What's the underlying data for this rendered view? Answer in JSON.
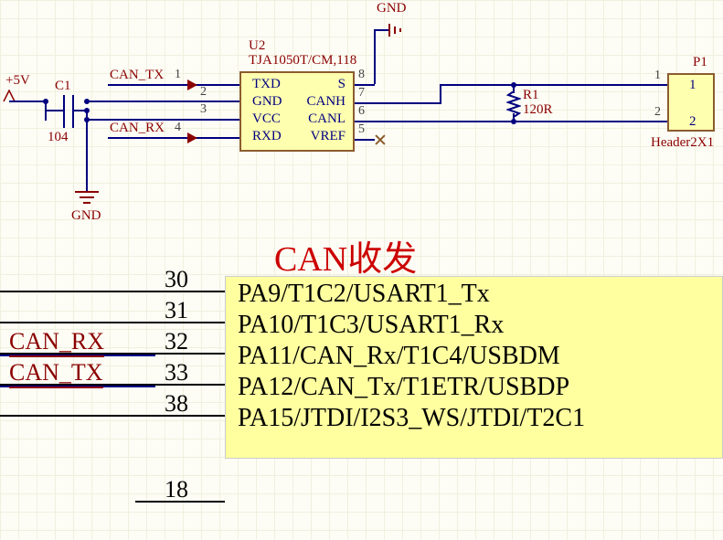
{
  "title": "CAN收发",
  "power": {
    "vcc": "+5V",
    "gnd_top": "GND",
    "gnd_left": "GND"
  },
  "c1": {
    "ref": "C1",
    "value": "104"
  },
  "u2": {
    "ref": "U2",
    "part": "TJA1050T/CM,118",
    "pins": {
      "p1": {
        "num": "1",
        "name": "TXD",
        "net": "CAN_TX"
      },
      "p2": {
        "num": "2",
        "name": "GND"
      },
      "p3": {
        "num": "3",
        "name": "VCC"
      },
      "p4": {
        "num": "4",
        "name": "RXD",
        "net": "CAN_RX"
      },
      "p5": {
        "num": "5",
        "name": "VREF"
      },
      "p6": {
        "num": "6",
        "name": "CANL"
      },
      "p7": {
        "num": "7",
        "name": "CANH"
      },
      "p8": {
        "num": "8",
        "name": "S"
      }
    }
  },
  "r1": {
    "ref": "R1",
    "value": "120R"
  },
  "p1": {
    "ref": "P1",
    "part": "Header2X1",
    "pin1": "1",
    "pin2": "2"
  },
  "mcu": {
    "pins": {
      "p30": {
        "num": "30",
        "func": "PA9/T1C2/USART1_Tx"
      },
      "p31": {
        "num": "31",
        "func": "PA10/T1C3/USART1_Rx"
      },
      "p32": {
        "num": "32",
        "func": "PA11/CAN_Rx/T1C4/USBDM",
        "net": "CAN_RX"
      },
      "p33": {
        "num": "33",
        "func": "PA12/CAN_Tx/T1ETR/USBDP",
        "net": "CAN_TX"
      },
      "p38": {
        "num": "38",
        "func": "PA15/JTDI/I2S3_WS/JTDI/T2C1"
      },
      "p18": {
        "num": "18"
      }
    }
  }
}
